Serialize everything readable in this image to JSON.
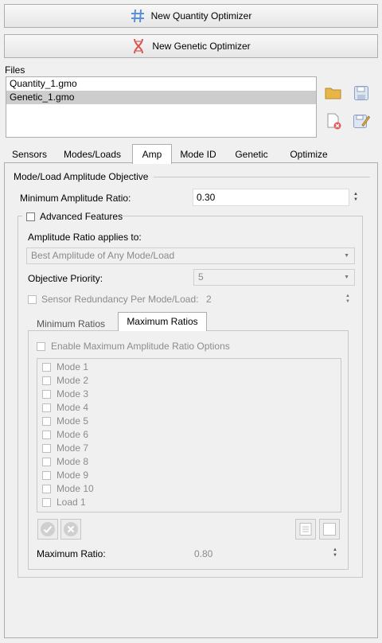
{
  "buttons": {
    "quantity_optimizer": "New Quantity Optimizer",
    "genetic_optimizer": "New Genetic Optimizer"
  },
  "files": {
    "label": "Files",
    "items": [
      "Quantity_1.gmo",
      "Genetic_1.gmo"
    ],
    "selected_index": 1
  },
  "tabs": [
    "Sensors",
    "Modes/Loads",
    "Amp",
    "Mode ID",
    "Genetic",
    "Optimize"
  ],
  "active_tab": "Amp",
  "amp": {
    "section_title": "Mode/Load Amplitude Objective",
    "min_amp_label": "Minimum Amplitude Ratio:",
    "min_amp_value": "0.30",
    "advanced_label": "Advanced Features",
    "applies_label": "Amplitude Ratio applies to:",
    "applies_value": "Best Amplitude of Any Mode/Load",
    "priority_label": "Objective Priority:",
    "priority_value": "5",
    "redundancy_label": "Sensor Redundancy Per Mode/Load:",
    "redundancy_value": "2",
    "subtabs": [
      "Minimum Ratios",
      "Maximum Ratios"
    ],
    "active_subtab": "Maximum Ratios",
    "enable_max_label": "Enable Maximum Amplitude Ratio Options",
    "modes": [
      "Mode 1",
      "Mode 2",
      "Mode 3",
      "Mode 4",
      "Mode 5",
      "Mode 6",
      "Mode 7",
      "Mode 8",
      "Mode 9",
      "Mode 10",
      "Load 1"
    ],
    "max_ratio_label": "Maximum Ratio:",
    "max_ratio_value": "0.80"
  },
  "colors": {
    "accent_blue": "#4a90d9",
    "genetic_red": "#d9534f",
    "folder_yellow": "#e8b548"
  }
}
